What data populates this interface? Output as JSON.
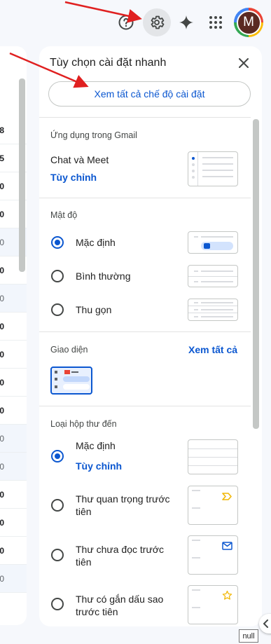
{
  "topbar": {
    "help_icon": "question-circle-icon",
    "settings_icon": "gear-icon",
    "gemini_icon": "sparkle-icon",
    "apps_icon": "apps-grid-icon",
    "avatar_letter": "M"
  },
  "mail_list": {
    "rows": [
      {
        "text": "8",
        "read": false
      },
      {
        "text": "5",
        "read": false
      },
      {
        "text": "0",
        "read": false
      },
      {
        "text": "0",
        "read": false
      },
      {
        "text": "0",
        "read": true
      },
      {
        "text": "0",
        "read": false
      },
      {
        "text": "0",
        "read": true
      },
      {
        "text": "0",
        "read": false
      },
      {
        "text": "0",
        "read": false
      },
      {
        "text": "0",
        "read": false
      },
      {
        "text": "0",
        "read": false
      },
      {
        "text": "0",
        "read": true
      },
      {
        "text": "0",
        "read": true
      },
      {
        "text": "0",
        "read": false
      },
      {
        "text": "0",
        "read": false
      },
      {
        "text": "0",
        "read": false
      },
      {
        "text": "0",
        "read": true
      }
    ]
  },
  "panel": {
    "title": "Tùy chọn cài đặt nhanh",
    "close_icon": "close-icon",
    "see_all_settings": "Xem tất cả chế độ cài đặt",
    "apps_section": {
      "title": "Ứng dụng trong Gmail",
      "item_label": "Chat và Meet",
      "customize": "Tùy chỉnh"
    },
    "density": {
      "title": "Mật độ",
      "options": [
        {
          "label": "Mặc định",
          "selected": true
        },
        {
          "label": "Bình thường",
          "selected": false
        },
        {
          "label": "Thu gọn",
          "selected": false
        }
      ]
    },
    "theme": {
      "title": "Giao diện",
      "see_all": "Xem tất cả"
    },
    "inbox_type": {
      "title": "Loại hộp thư đến",
      "options": [
        {
          "label": "Mặc định",
          "selected": true,
          "sub_link": "Tùy chỉnh"
        },
        {
          "label": "Thư quan trọng trước tiên",
          "selected": false,
          "icon": "important-marker-icon"
        },
        {
          "label": "Thư chưa đọc trước tiên",
          "selected": false,
          "icon": "envelope-icon"
        },
        {
          "label": "Thư có gắn dấu sao trước tiên",
          "selected": false,
          "icon": "star-icon"
        }
      ]
    }
  },
  "side_toggle_icon": "chevron-left-icon",
  "tooltip": "null",
  "colors": {
    "accent": "#0b57d0",
    "annotation_arrow": "#e02020",
    "important": "#f2b705",
    "star": "#f2b705"
  }
}
